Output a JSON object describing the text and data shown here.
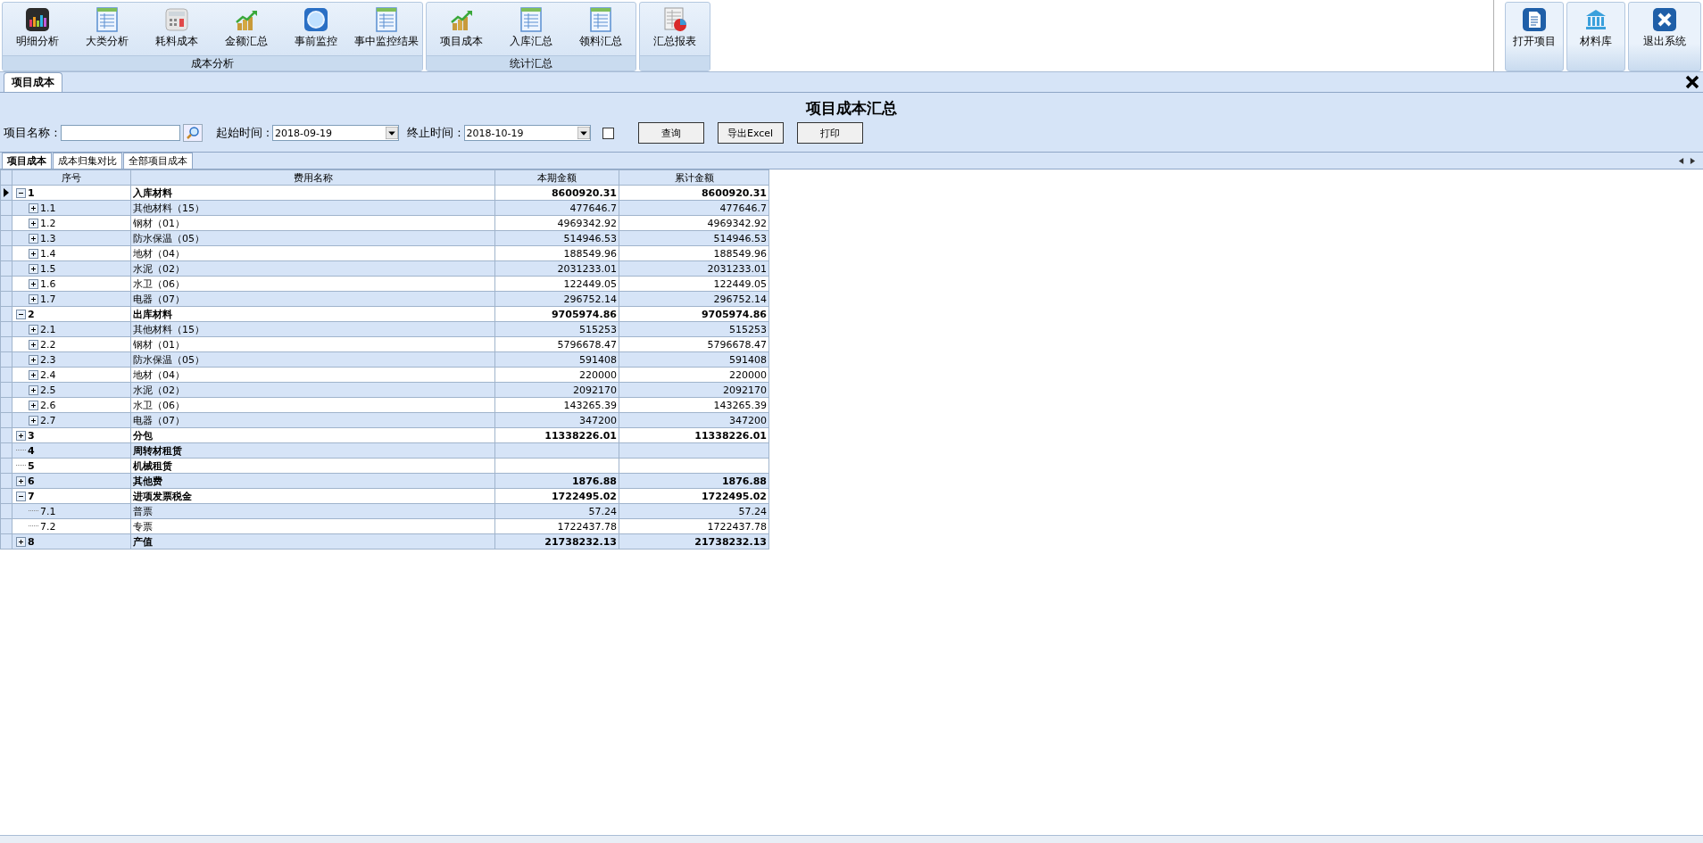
{
  "toolbar": {
    "groups": [
      {
        "label": "成本分析",
        "buttons": [
          "明细分析",
          "大类分析",
          "耗料成本",
          "金额汇总",
          "事前监控",
          "事中监控结果"
        ]
      },
      {
        "label": "统计汇总",
        "buttons": [
          "项目成本",
          "入库汇总",
          "领料汇总"
        ]
      },
      {
        "buttons": [
          "汇总报表"
        ]
      }
    ],
    "right_buttons": [
      "打开项目",
      "材料库",
      "退出系统"
    ]
  },
  "doc_tab": {
    "label": "项目成本",
    "selected": true
  },
  "report": {
    "title": "项目成本汇总",
    "filters": {
      "name_label": "项目名称 :",
      "start_label": "起始时间 :",
      "start_value": "2018-09-19",
      "end_label": "终止时间 :",
      "end_value": "2018-10-19",
      "checkbox_checked": false,
      "buttons": [
        "查询",
        "导出Excel",
        "打印"
      ]
    }
  },
  "sub_tabs": [
    {
      "label": "项目成本",
      "selected": true
    },
    {
      "label": "成本归集对比",
      "selected": false
    },
    {
      "label": "全部项目成本",
      "selected": false
    }
  ],
  "table": {
    "columns": [
      "序号",
      "费用名称",
      "本期金额",
      "累计金额"
    ],
    "rows": [
      {
        "no": "1",
        "name": "入库材料",
        "current": "8600920.31",
        "total": "8600920.31",
        "expanded": true,
        "selected": true,
        "children": [
          {
            "no": "1.1",
            "name": "其他材料（15）",
            "current": "477646.7",
            "total": "477646.7",
            "expanded": false,
            "selected": false
          },
          {
            "no": "1.2",
            "name": "钢材（01）",
            "current": "4969342.92",
            "total": "4969342.92",
            "expanded": false,
            "selected": false
          },
          {
            "no": "1.3",
            "name": "防水保温（05）",
            "current": "514946.53",
            "total": "514946.53",
            "expanded": false,
            "selected": false
          },
          {
            "no": "1.4",
            "name": "地材（04）",
            "current": "188549.96",
            "total": "188549.96",
            "expanded": false,
            "selected": false
          },
          {
            "no": "1.5",
            "name": "水泥（02）",
            "current": "2031233.01",
            "total": "2031233.01",
            "expanded": false,
            "selected": false
          },
          {
            "no": "1.6",
            "name": "水卫（06）",
            "current": "122449.05",
            "total": "122449.05",
            "expanded": false,
            "selected": false
          },
          {
            "no": "1.7",
            "name": "电器（07）",
            "current": "296752.14",
            "total": "296752.14",
            "expanded": false,
            "selected": false
          }
        ]
      },
      {
        "no": "2",
        "name": "出库材料",
        "current": "9705974.86",
        "total": "9705974.86",
        "expanded": true,
        "selected": false,
        "children": [
          {
            "no": "2.1",
            "name": "其他材料（15）",
            "current": "515253",
            "total": "515253",
            "expanded": false,
            "selected": false
          },
          {
            "no": "2.2",
            "name": "钢材（01）",
            "current": "5796678.47",
            "total": "5796678.47",
            "expanded": false,
            "selected": false
          },
          {
            "no": "2.3",
            "name": "防水保温（05）",
            "current": "591408",
            "total": "591408",
            "expanded": false,
            "selected": false
          },
          {
            "no": "2.4",
            "name": "地材（04）",
            "current": "220000",
            "total": "220000",
            "expanded": false,
            "selected": false
          },
          {
            "no": "2.5",
            "name": "水泥（02）",
            "current": "2092170",
            "total": "2092170",
            "expanded": false,
            "selected": false
          },
          {
            "no": "2.6",
            "name": "水卫（06）",
            "current": "143265.39",
            "total": "143265.39",
            "expanded": false,
            "selected": false
          },
          {
            "no": "2.7",
            "name": "电器（07）",
            "current": "347200",
            "total": "347200",
            "expanded": false,
            "selected": false
          }
        ]
      },
      {
        "no": "3",
        "name": "分包",
        "current": "11338226.01",
        "total": "11338226.01",
        "expanded": false,
        "selected": false
      },
      {
        "no": "4",
        "name": "周转材租赁",
        "selected": false
      },
      {
        "no": "5",
        "name": "机械租赁",
        "selected": false
      },
      {
        "no": "6",
        "name": "其他费",
        "current": "1876.88",
        "total": "1876.88",
        "expanded": false,
        "selected": false
      },
      {
        "no": "7",
        "name": "进项发票税金",
        "current": "1722495.02",
        "total": "1722495.02",
        "expanded": true,
        "selected": false,
        "children": [
          {
            "no": "7.1",
            "name": "普票",
            "current": "57.24",
            "total": "57.24",
            "selected": false
          },
          {
            "no": "7.2",
            "name": "专票",
            "current": "1722437.78",
            "total": "1722437.78",
            "selected": false
          }
        ]
      },
      {
        "no": "8",
        "name": "产值",
        "current": "21738232.13",
        "total": "21738232.13",
        "expanded": false,
        "selected": false
      }
    ]
  }
}
